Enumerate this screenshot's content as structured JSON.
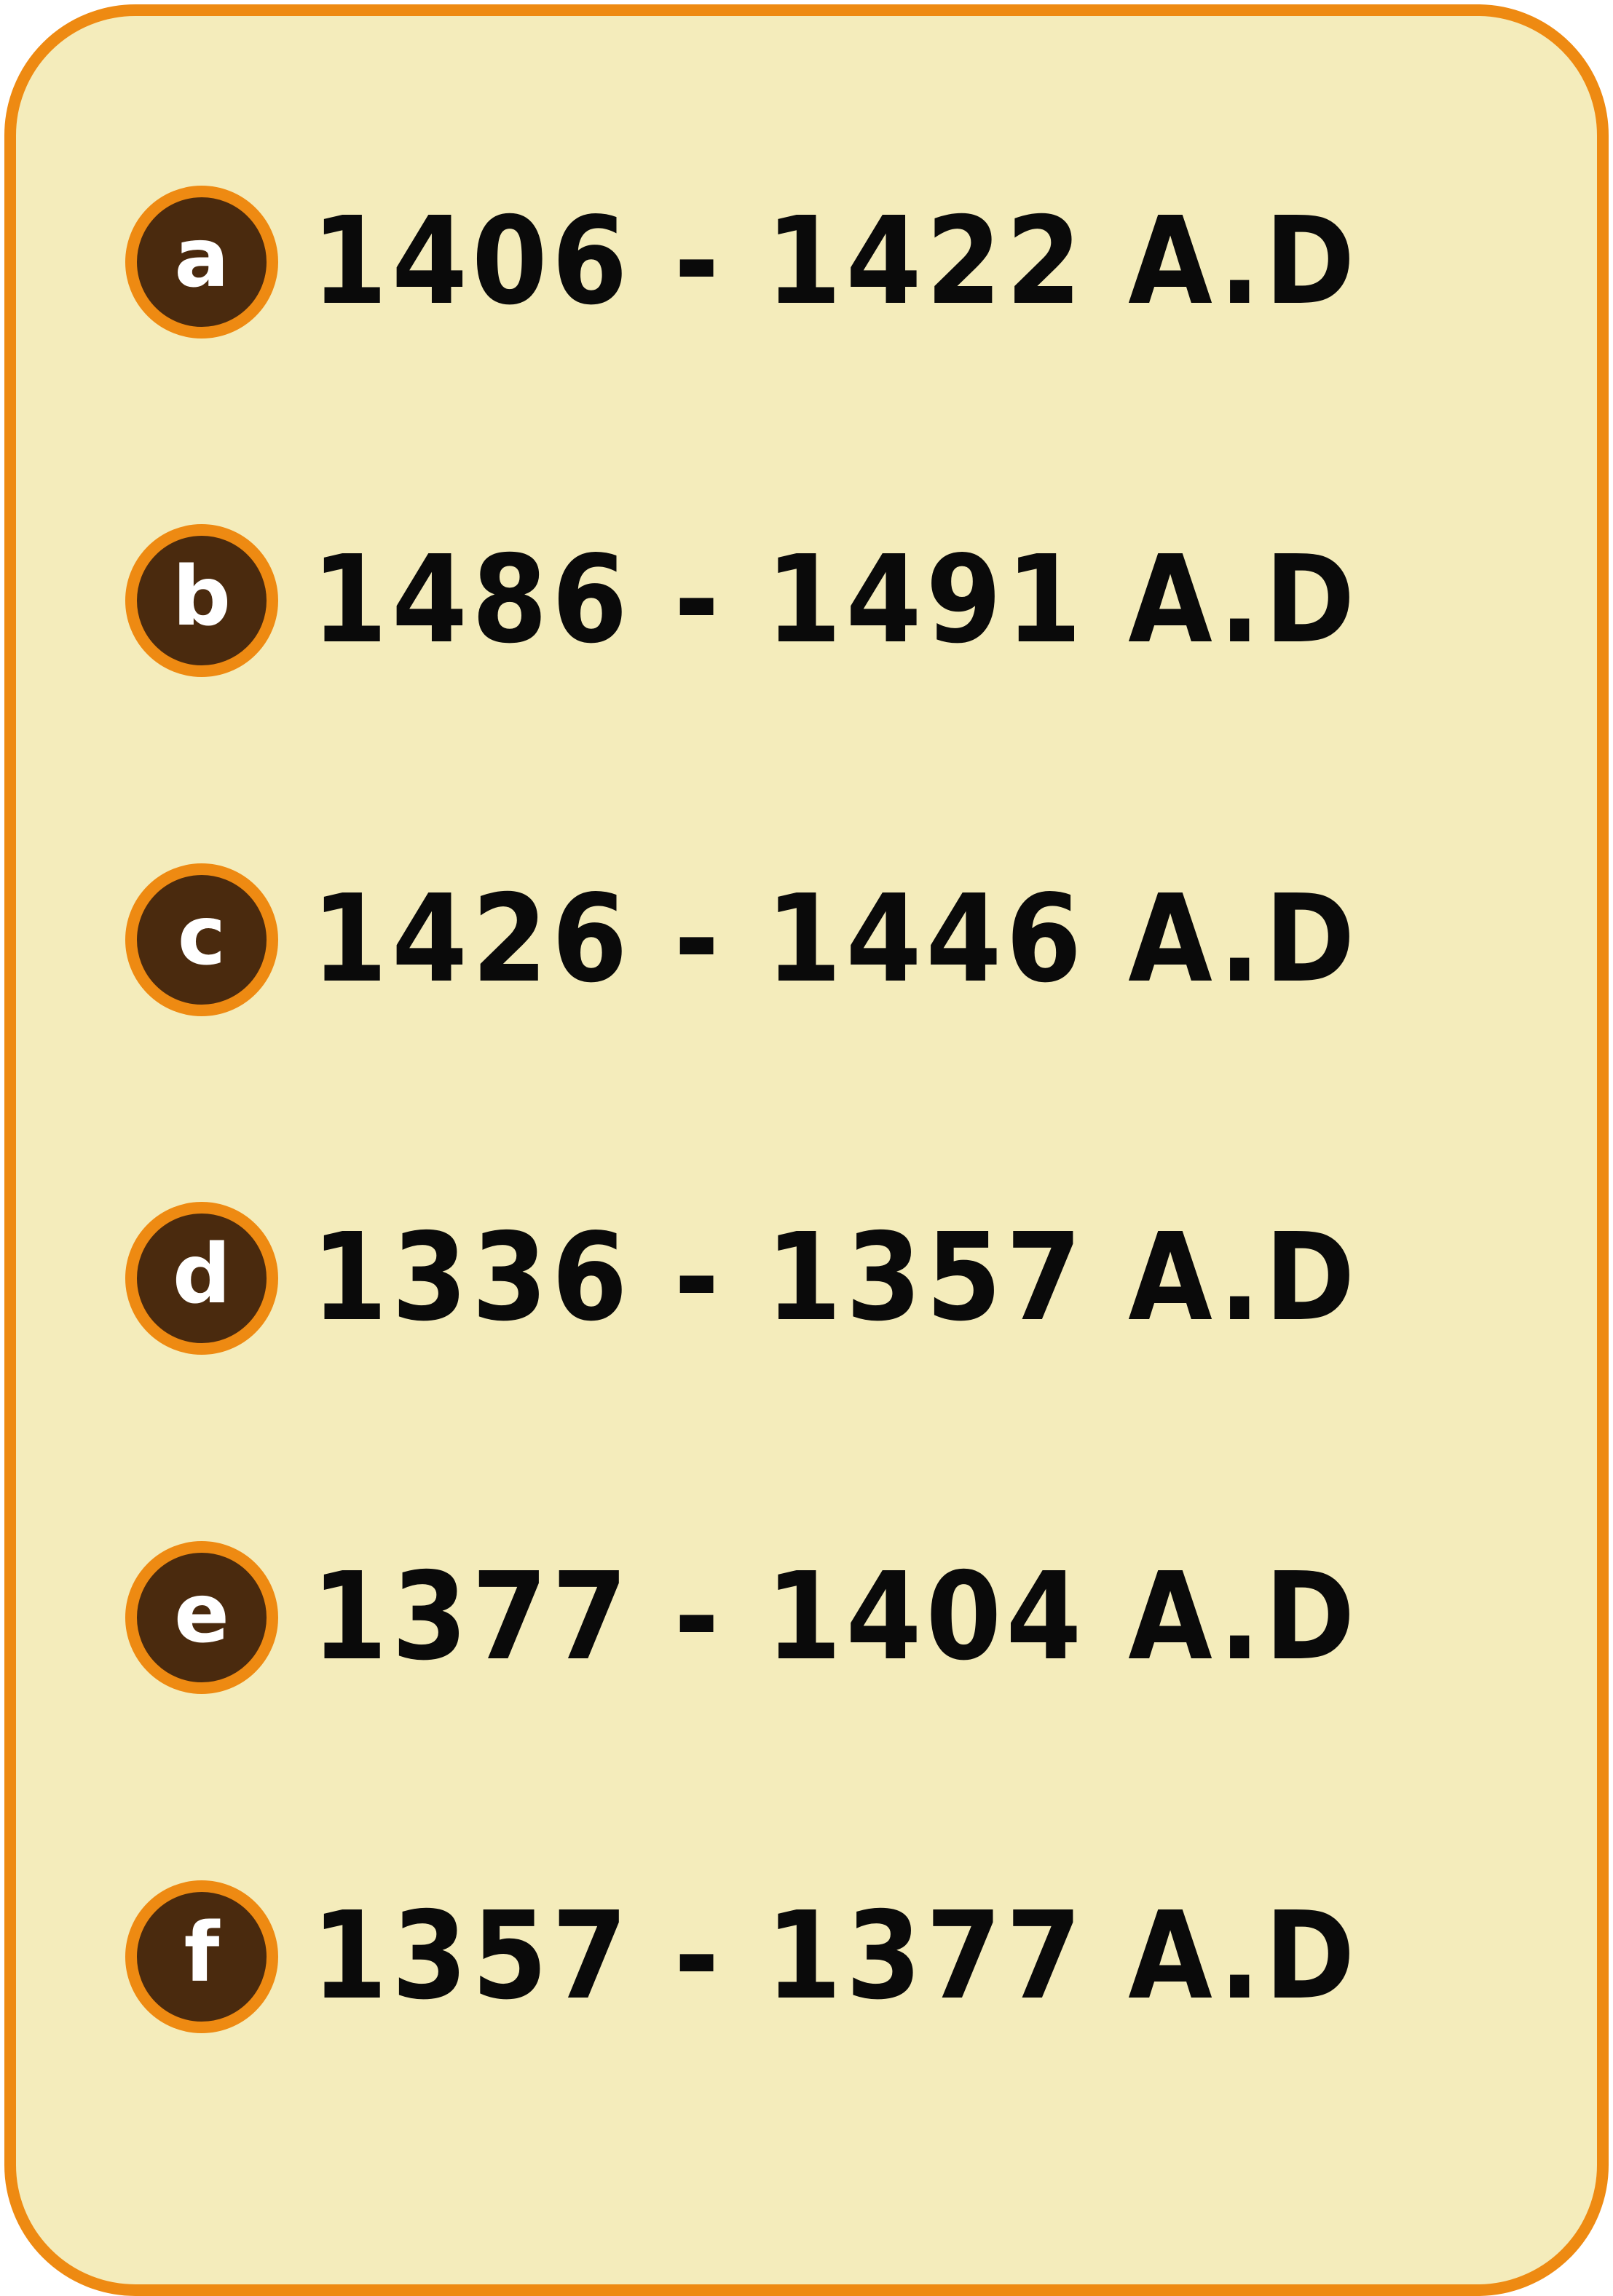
{
  "options": [
    {
      "letter": "a",
      "text": "1406 - 1422 A.D"
    },
    {
      "letter": "b",
      "text": "1486 - 1491 A.D"
    },
    {
      "letter": "c",
      "text": "1426 - 1446 A.D"
    },
    {
      "letter": "d",
      "text": "1336 - 1357 A.D"
    },
    {
      "letter": "e",
      "text": "1377 - 1404 A.D"
    },
    {
      "letter": "f",
      "text": "1357 - 1377 A.D"
    }
  ],
  "colors": {
    "background": "#f4ecbb",
    "border": "#ee8a12",
    "badge": "#4a2a0e",
    "text": "#0a0a0a"
  }
}
